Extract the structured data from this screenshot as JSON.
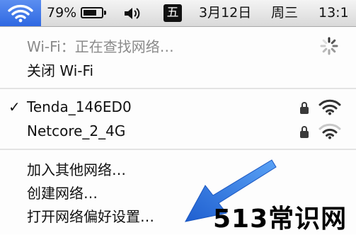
{
  "menubar": {
    "wifi_icon": "wifi-icon",
    "battery_percent": "79%",
    "battery_icon": "battery-icon",
    "volume_icon": "speaker-icon",
    "input_method": "五",
    "date": "3月12日",
    "weekday": "周三",
    "time": "13:1"
  },
  "wifi_menu": {
    "status": "Wi-Fi：正在查找网络…",
    "toggle_label": "关闭 Wi-Fi",
    "networks": [
      {
        "name": "Tenda_146ED0",
        "connected": true,
        "secured": true
      },
      {
        "name": "Netcore_2_4G",
        "connected": false,
        "secured": true
      }
    ],
    "actions": [
      "加入其他网络…",
      "创建网络…",
      "打开网络偏好设置…"
    ],
    "checkmark": "✓"
  },
  "watermark": "513常识网",
  "colors": {
    "highlight": "#3a73e8",
    "arrow": "#2f78e0",
    "disabled_text": "#8a8a8a"
  }
}
